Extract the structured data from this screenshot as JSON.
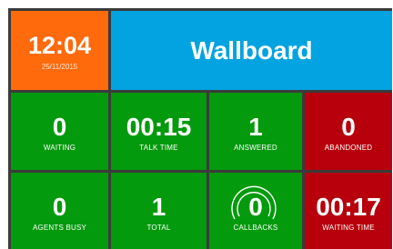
{
  "clock": {
    "time": "12:04",
    "date": "25/11/2015"
  },
  "header": {
    "title": "Wallboard"
  },
  "stats": {
    "waiting": {
      "value": "0",
      "label": "WAITING"
    },
    "talk_time": {
      "value": "00:15",
      "label": "TALK TIME"
    },
    "answered": {
      "value": "1",
      "label": "ANSWERED"
    },
    "abandoned": {
      "value": "0",
      "label": "ABANDONED"
    },
    "agents_busy": {
      "value": "0",
      "label": "AGENTS BUSY"
    },
    "total": {
      "value": "1",
      "label": "TOTAL"
    },
    "callbacks": {
      "value": "0",
      "label": "CALLBACKS"
    },
    "waiting_time": {
      "value": "00:17",
      "label": "WAITING TIME"
    }
  },
  "colors": {
    "orange": "#ff6a0d",
    "blue": "#02a3e0",
    "green": "#049a0d",
    "red": "#b7000b",
    "grid": "#3b3b3b"
  }
}
